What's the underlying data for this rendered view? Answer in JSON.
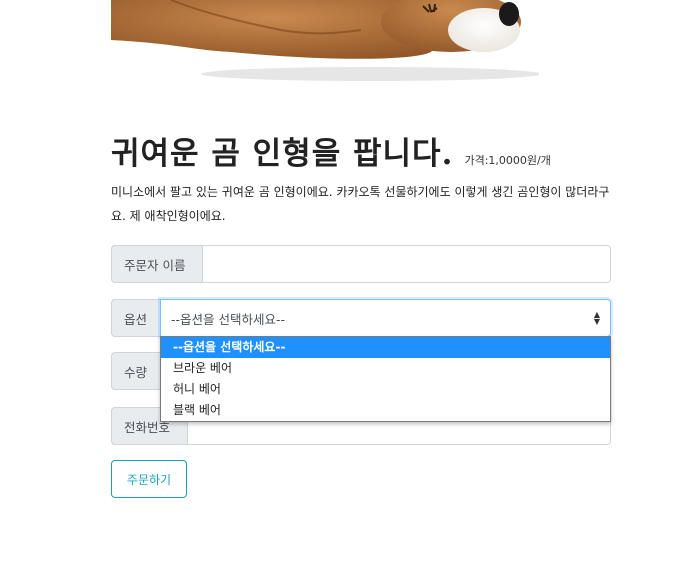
{
  "product": {
    "title": "귀여운 곰 인형을 팝니다.",
    "price": "가격:1,0000원/개",
    "description": "미니소에서 팔고 있는 귀여운 곰 인형이에요. 카카오톡 선물하기에도 이렇게 생긴 곰인형이 많더라구요. 제 애착인형이에요."
  },
  "form": {
    "name_label": "주문자 이름",
    "name_value": "",
    "option_label": "옵션",
    "option_selected": "--옵션을 선택하세요--",
    "options": [
      "--옵션을 선택하세요--",
      "브라운 베어",
      "허니 베어",
      "블랙 베어"
    ],
    "quantity_label": "수량",
    "phone_label": "전화번호",
    "submit_label": "주문하기"
  },
  "colors": {
    "accent": "#17a2b8",
    "dropdown_highlight": "#1e90ff",
    "focus_border": "#80bdff"
  }
}
